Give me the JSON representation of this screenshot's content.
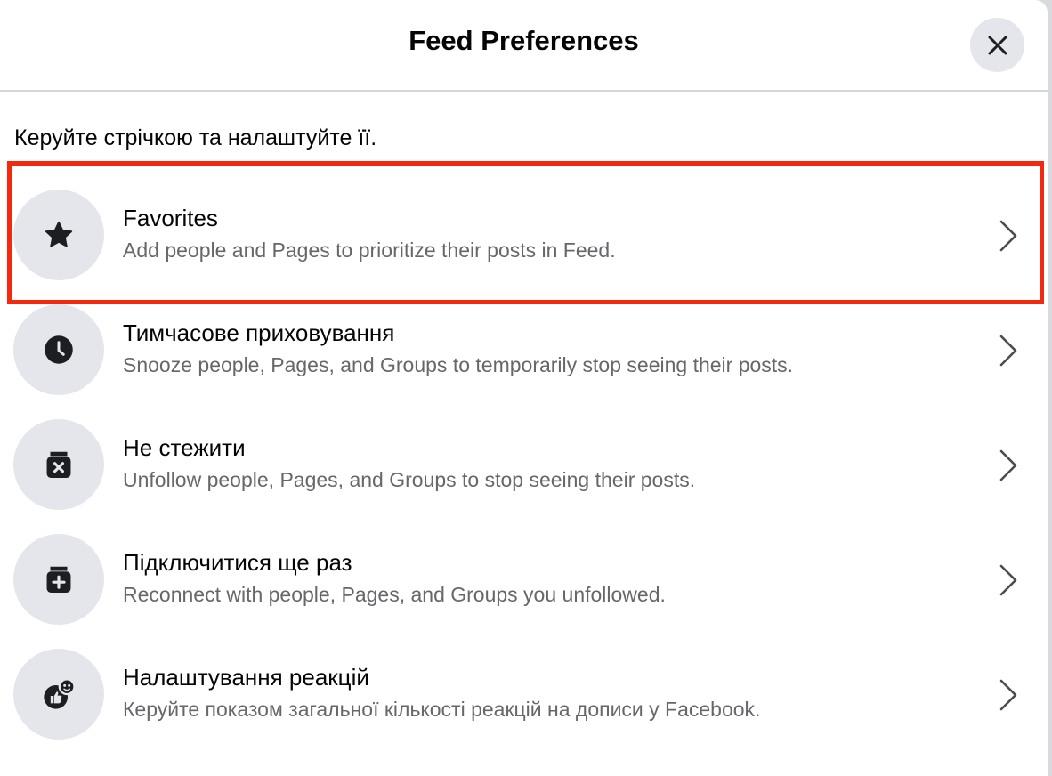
{
  "dialog": {
    "title": "Feed Preferences",
    "subtitle": "Керуйте стрічкою та налаштуйте її."
  },
  "items": [
    {
      "title": "Favorites",
      "description": "Add people and Pages to prioritize their posts in Feed.",
      "icon": "star-icon",
      "highlighted": true
    },
    {
      "title": "Тимчасове приховування",
      "description": "Snooze people, Pages, and Groups to temporarily stop seeing their posts.",
      "icon": "clock-icon"
    },
    {
      "title": "Не стежити",
      "description": "Unfollow people, Pages, and Groups to stop seeing their posts.",
      "icon": "box-x-icon"
    },
    {
      "title": "Підключитися ще раз",
      "description": "Reconnect with people, Pages, and Groups you unfollowed.",
      "icon": "box-plus-icon"
    },
    {
      "title": "Налаштування реакцій",
      "description": "Керуйте показом загальної кількості реакцій на дописи у Facebook.",
      "icon": "reactions-icon"
    }
  ],
  "colors": {
    "highlight_border": "#f2290f",
    "icon_circle_bg": "#e4e6eb",
    "primary_text": "#050505",
    "secondary_text": "#65676b"
  }
}
